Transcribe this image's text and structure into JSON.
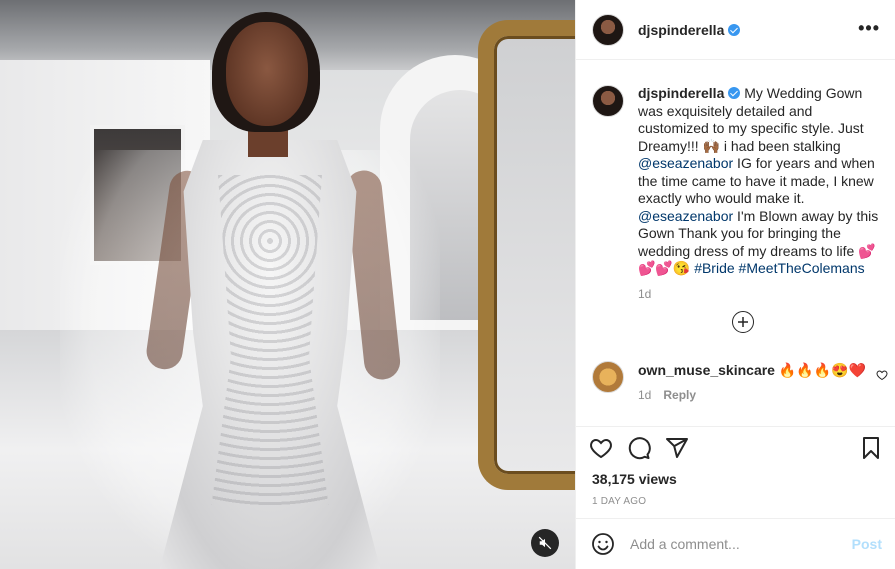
{
  "post": {
    "username": "djspinderella",
    "more_label": "•••"
  },
  "caption": {
    "username": "djspinderella",
    "text_1": " My Wedding Gown was exquisitely detailed and customized to my specific style. Just Dreamy!!! 🙌🏾 i had been stalking ",
    "mention_1": "@eseazenabor",
    "text_2": " IG for years and when the time came to have it made, I knew exactly who would make it. ",
    "mention_2": "@eseazenabor",
    "text_3": " I'm Blown away by this Gown Thank you for bringing the wedding dress of my dreams to life 💕💕💕😘 ",
    "hashtag_1": "#Bride",
    "hashtag_2": "#MeetTheColemans",
    "time": "1d"
  },
  "comments": [
    {
      "username": "own_muse_skincare",
      "text": " 🔥🔥🔥😍❤️",
      "time": "1d",
      "reply_label": "Reply"
    }
  ],
  "stats": {
    "views": "38,175 views",
    "time_ago": "1 DAY AGO"
  },
  "composer": {
    "placeholder": "Add a comment...",
    "post_label": "Post"
  },
  "icons": {
    "like": "heart-icon",
    "comment": "comment-icon",
    "share": "share-icon",
    "save": "bookmark-icon",
    "emoji": "emoji-icon",
    "mute": "muted-speaker-icon",
    "add": "plus-circle-icon"
  },
  "colors": {
    "link": "#00376b",
    "verified": "#3897f0",
    "post_disabled": "#b2dffc"
  }
}
